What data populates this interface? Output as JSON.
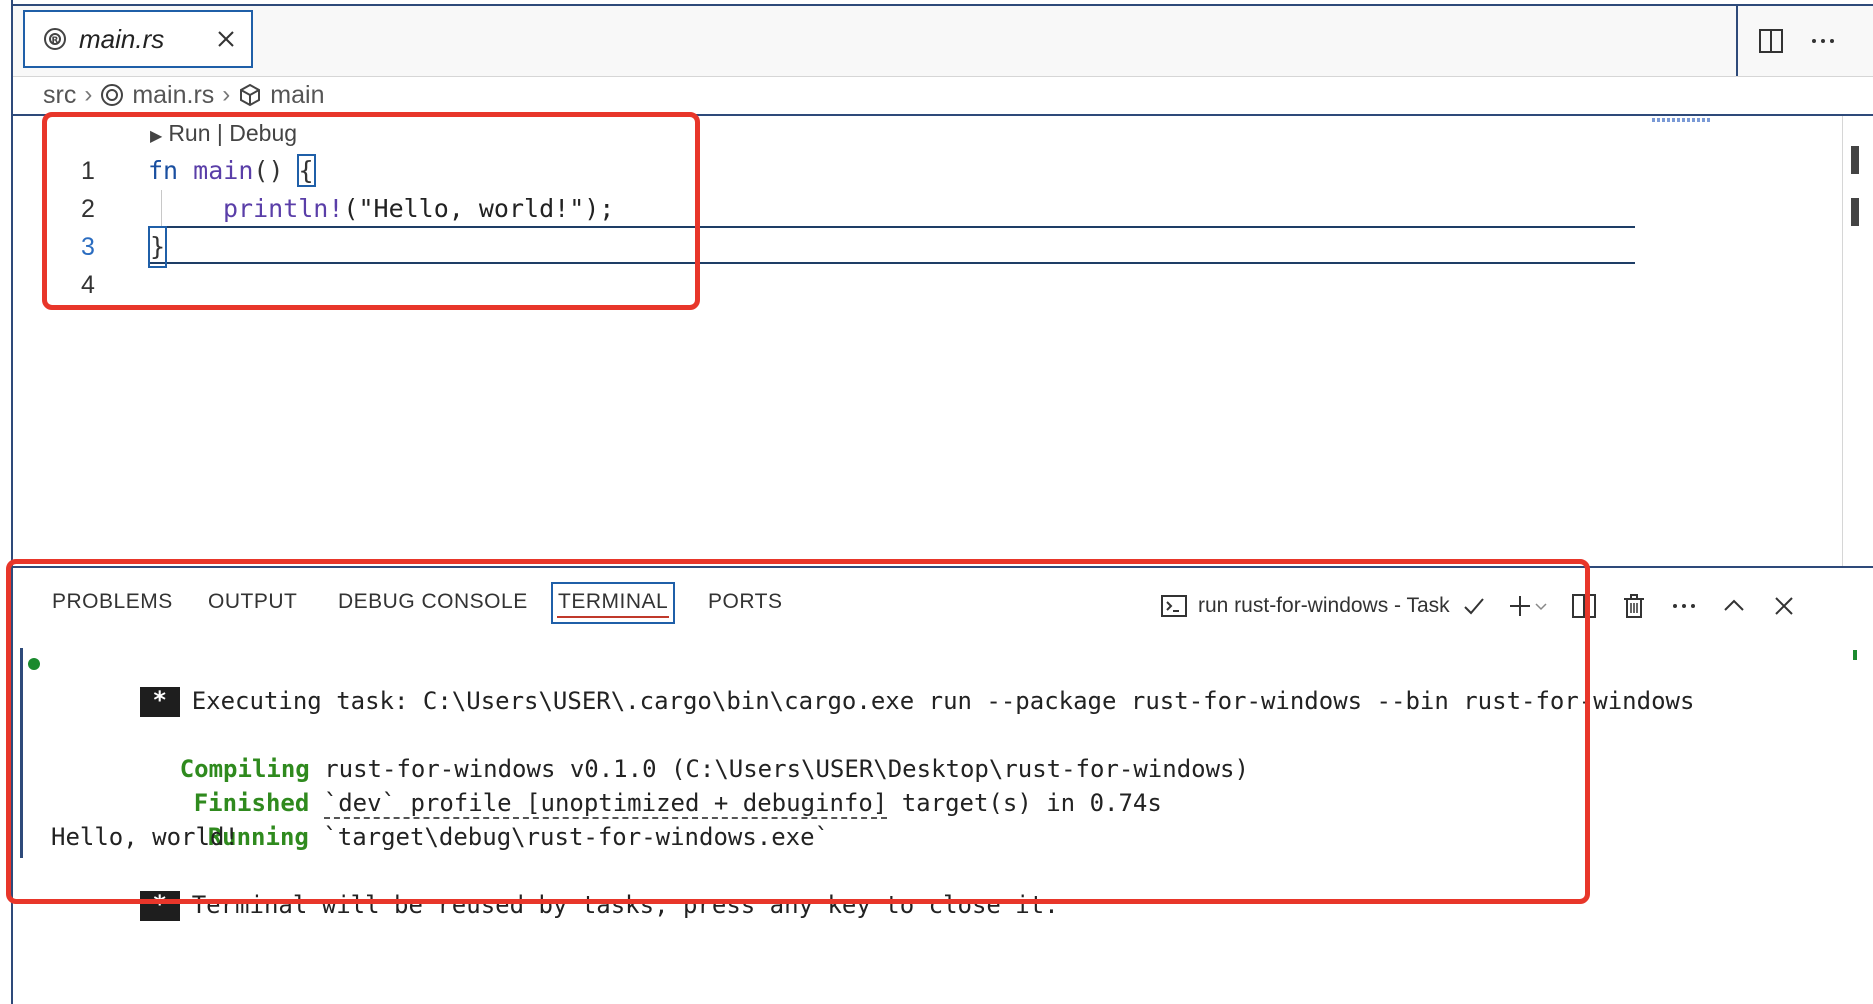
{
  "tab": {
    "label": "main.rs",
    "icon": "rust-file-icon"
  },
  "breadcrumb": {
    "items": [
      "src",
      "main.rs",
      "main"
    ]
  },
  "editor": {
    "codelens": "Run | Debug",
    "lines": [
      {
        "num": "1",
        "kw": "fn",
        "rest_fn": "main",
        "tail": "() ",
        "brace": "{"
      },
      {
        "num": "2",
        "macro": "println!",
        "args": "(\"Hello, world!\");"
      },
      {
        "num": "3",
        "text": "}"
      },
      {
        "num": "4",
        "text": ""
      }
    ]
  },
  "panel": {
    "tabs": [
      "PROBLEMS",
      "OUTPUT",
      "DEBUG CONSOLE",
      "TERMINAL",
      "PORTS"
    ],
    "active_tab": "TERMINAL",
    "task_label": "run rust-for-windows - Task"
  },
  "terminal": {
    "badge": "*",
    "executing": "Executing task: C:\\Users\\USER\\.cargo\\bin\\cargo.exe run --package rust-for-windows --bin rust-for-windows",
    "compiling_kw": "Compiling",
    "compiling_text": " rust-for-windows v0.1.0 (C:\\Users\\USER\\Desktop\\rust-for-windows)",
    "finished_kw": "Finished",
    "finished_dev": "`dev` profile [unoptimized + debuginfo]",
    "finished_tail": " target(s) in 0.74s",
    "running_kw": "Running",
    "running_text": " `target\\debug\\rust-for-windows.exe`",
    "output": "Hello, world!",
    "reuse": "Terminal will be reused by tasks, press any key to close it."
  },
  "colors": {
    "highlight_red": "#e8362a",
    "accent_blue": "#1f5fa8",
    "cargo_green": "#2f8a1e"
  }
}
